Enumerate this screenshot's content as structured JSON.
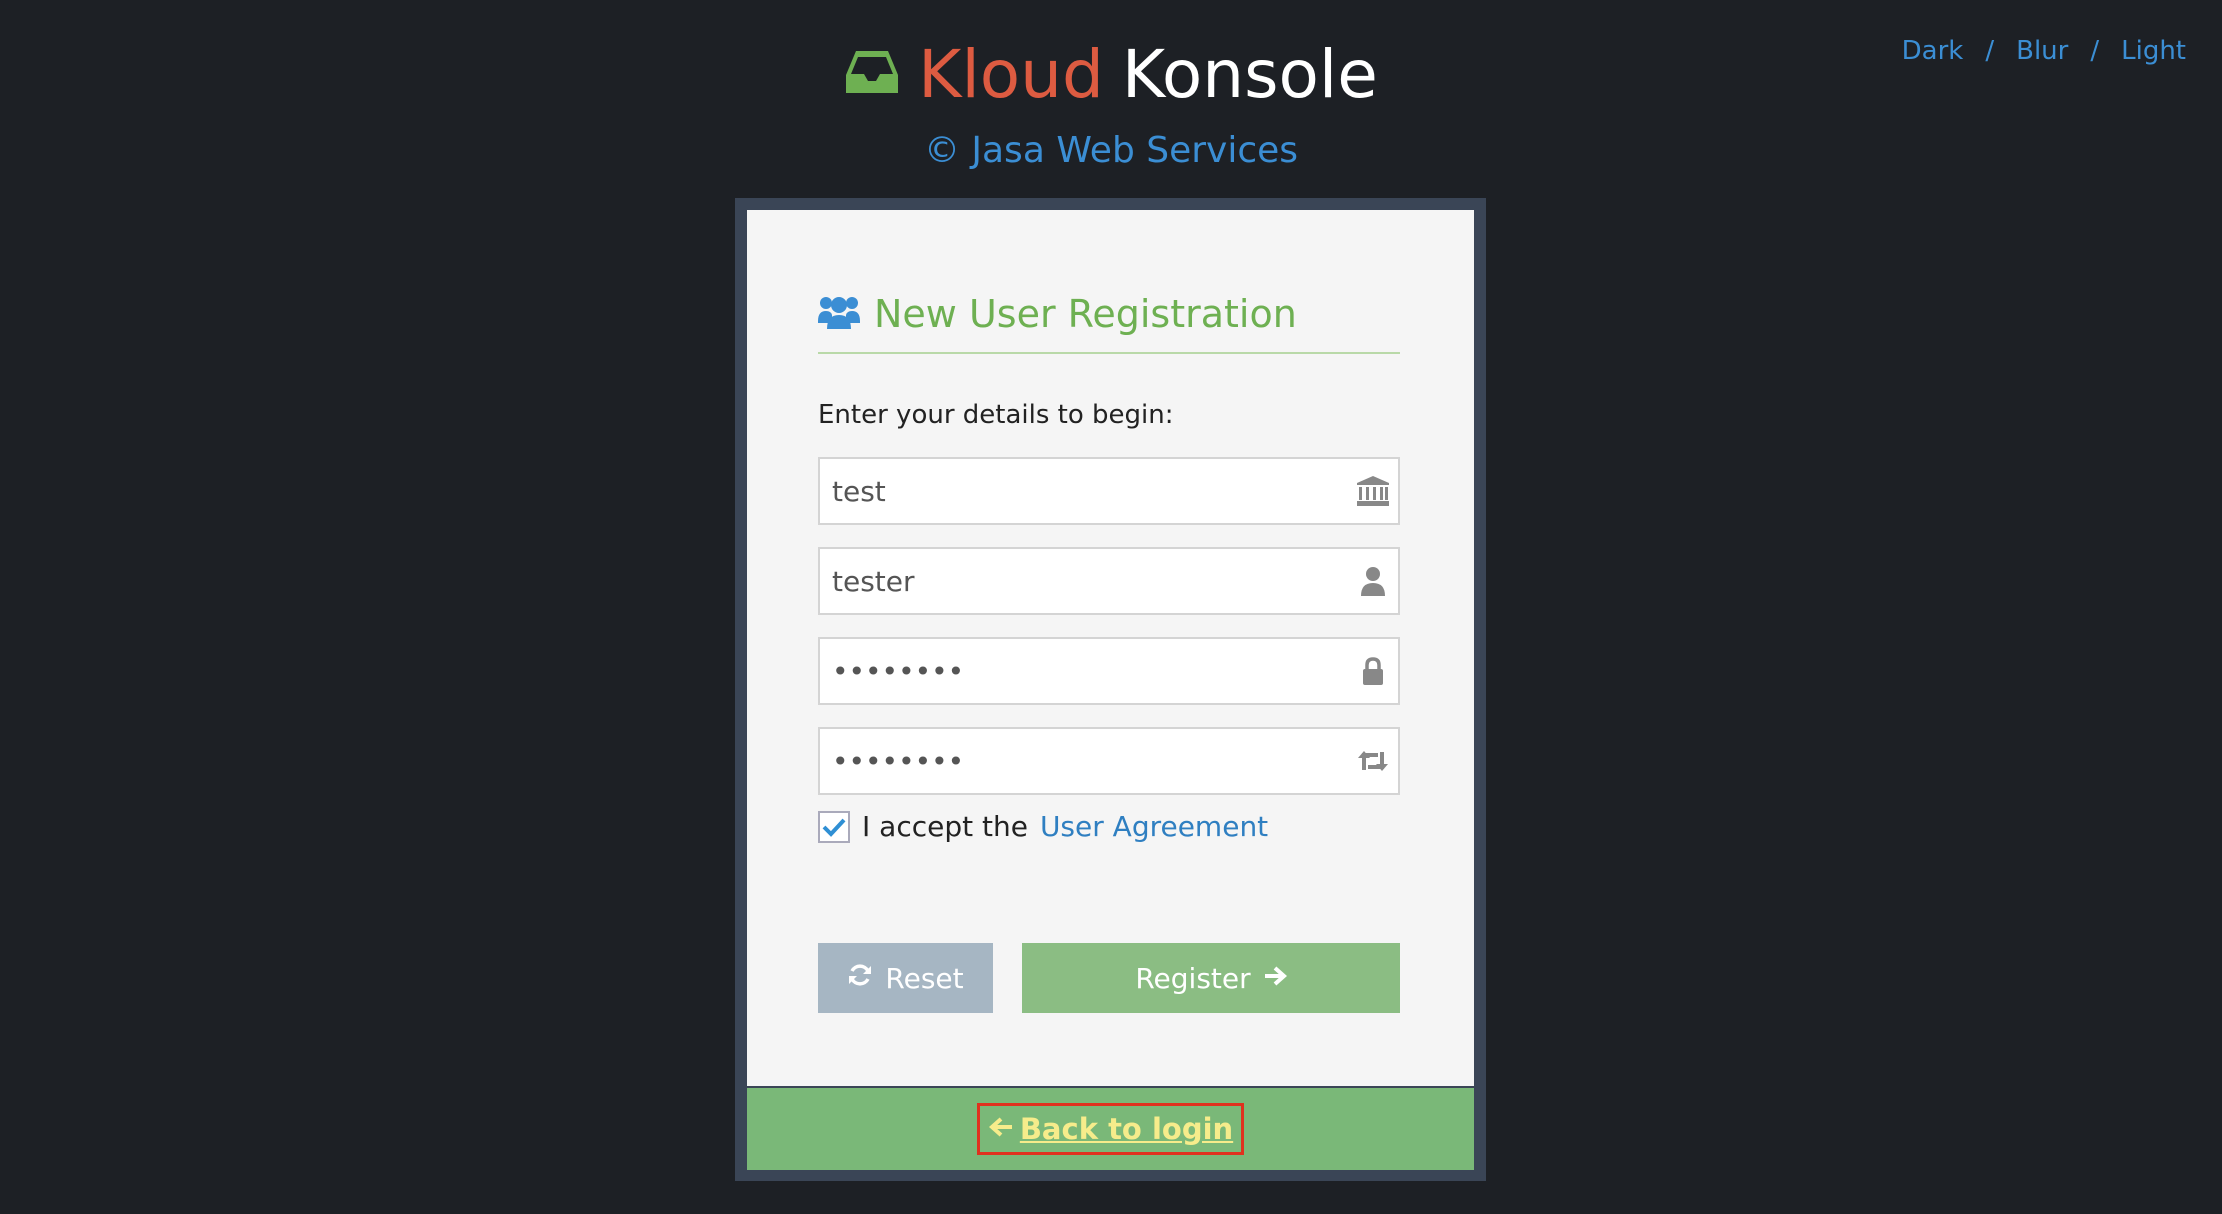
{
  "theme": {
    "dark": "Dark",
    "sep": "/",
    "blur": "Blur",
    "light": "Light"
  },
  "brand": {
    "word1": "Kloud",
    "word2": "Konsole",
    "subtitle": "© Jasa Web Services",
    "icon": "inbox-icon"
  },
  "registration": {
    "title": "New User Registration",
    "title_icon": "users-icon",
    "intro": "Enter your details to begin:",
    "fields": [
      {
        "value": "test",
        "type": "text",
        "icon": "bank-icon"
      },
      {
        "value": "tester",
        "type": "text",
        "icon": "user-icon"
      },
      {
        "value": "••••••••",
        "type": "password",
        "icon": "lock-icon"
      },
      {
        "value": "••••••••",
        "type": "password",
        "icon": "retweet-icon"
      }
    ],
    "accept_text": "I accept the",
    "accept_link": "User Agreement",
    "accepted": true
  },
  "buttons": {
    "reset": "Reset",
    "register": "Register"
  },
  "footer": {
    "back": "Back to login"
  },
  "colors": {
    "accent_green": "#6eb052",
    "link_blue": "#3b8ed4",
    "brand_red": "#dd5b41",
    "back_highlight": "#e0311e"
  }
}
